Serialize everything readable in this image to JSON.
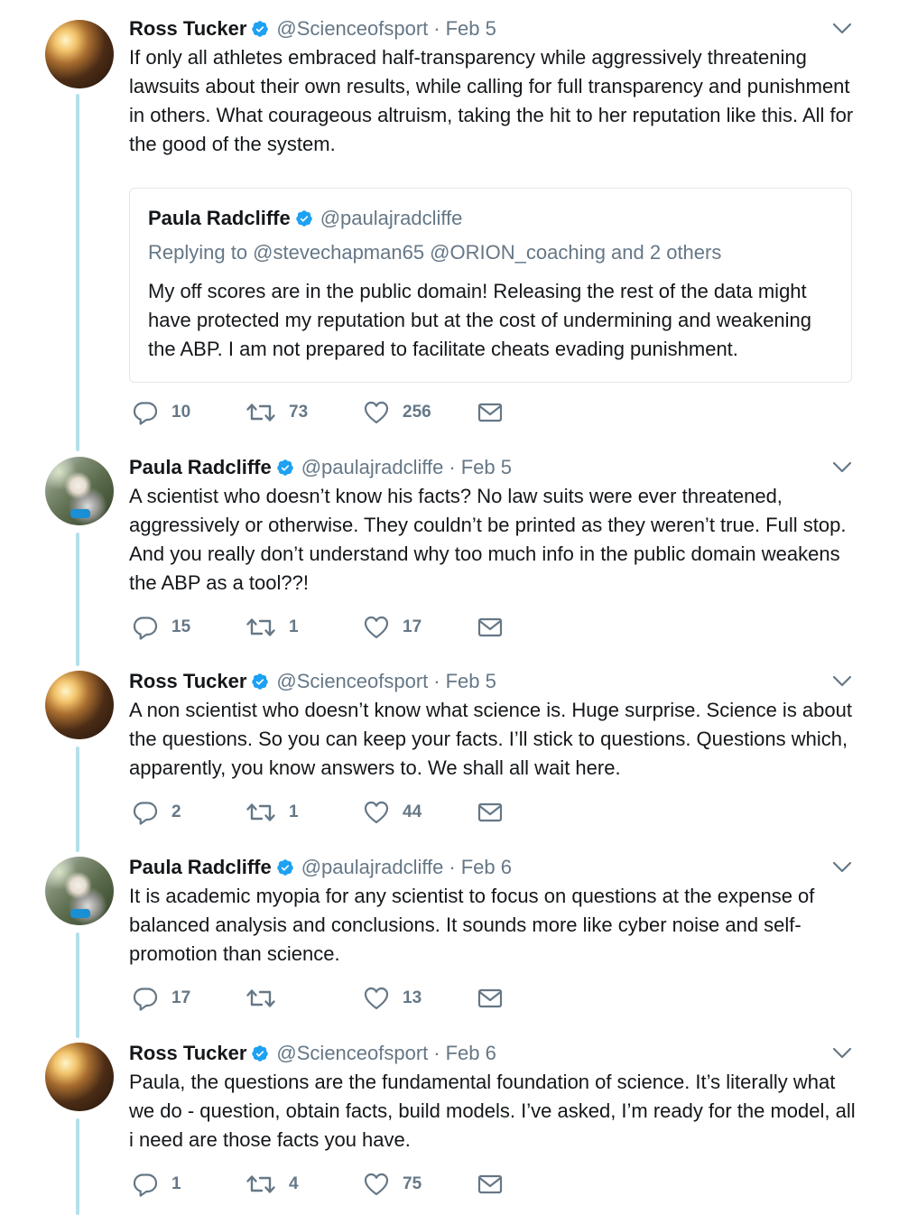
{
  "tweets": [
    {
      "author": "Ross Tucker",
      "handle": "@Scienceofsport",
      "separator": "·",
      "date": "Feb 5",
      "avatar": "avatar-ross",
      "text": "If only all athletes embraced half-transparency while aggressively threatening lawsuits about their own results, while calling for full transparency and punishment in others. What courageous altruism, taking the hit to her reputation like this. All for the good of the system.",
      "quote": {
        "author": "Paula Radcliffe",
        "handle": "@paulajradcliffe",
        "replying": "Replying to @stevechapman65 @ORION_coaching and 2 others",
        "text": "My off scores are in the public domain! Releasing the rest of the data might have protected my reputation but at the cost of undermining and weakening the ABP. I am not prepared to facilitate cheats evading punishment."
      },
      "replies": "10",
      "retweets": "73",
      "likes": "256"
    },
    {
      "author": "Paula Radcliffe",
      "handle": "@paulajradcliffe",
      "separator": "·",
      "date": "Feb 5",
      "avatar": "avatar-paula",
      "text": "A scientist who doesn’t know his facts? No law suits were ever threatened, aggressively or otherwise. They couldn’t be printed as they weren’t true. Full stop. And you really don’t understand why too much info in the public domain weakens the ABP as a tool??!",
      "replies": "15",
      "retweets": "1",
      "likes": "17"
    },
    {
      "author": "Ross Tucker",
      "handle": "@Scienceofsport",
      "separator": "·",
      "date": "Feb 5",
      "avatar": "avatar-ross",
      "text": "A non scientist who doesn’t know what science is. Huge surprise. Science is about the questions. So you can keep your facts. I’ll stick to questions. Questions which, apparently, you know answers to. We shall all wait here.",
      "replies": "2",
      "retweets": "1",
      "likes": "44"
    },
    {
      "author": "Paula Radcliffe",
      "handle": "@paulajradcliffe",
      "separator": "·",
      "date": "Feb 6",
      "avatar": "avatar-paula",
      "text": "It is academic myopia for any scientist to focus on questions at the expense of balanced analysis and conclusions. It sounds more like cyber noise and self-promotion than science.",
      "replies": "17",
      "retweets": "",
      "likes": "13"
    },
    {
      "author": "Ross Tucker",
      "handle": "@Scienceofsport",
      "separator": "·",
      "date": "Feb 6",
      "avatar": "avatar-ross",
      "text": "Paula, the questions are the fundamental foundation of science.  It’s literally what we do - question, obtain facts, build models. I’ve asked, I’m ready for the model, all i need are those facts you have.",
      "replies": "1",
      "retweets": "4",
      "likes": "75"
    }
  ],
  "icons": {
    "reply": "reply-icon",
    "retweet": "retweet-icon",
    "like": "heart-icon",
    "dm": "envelope-icon",
    "verified": "verified-badge-icon",
    "menu": "chevron-down-icon"
  },
  "colors": {
    "text": "#14171a",
    "secondary": "#657786",
    "verified": "#1da1f2",
    "thread_line": "#b4e0ec",
    "border": "#e1e8ed"
  }
}
